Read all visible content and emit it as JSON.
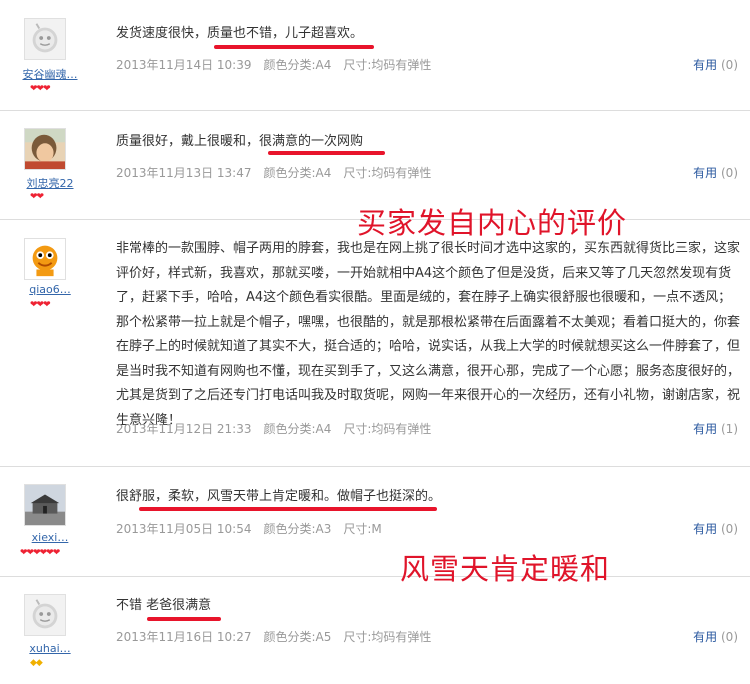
{
  "reviews": [
    {
      "avatar_icon": "default-avatar-icon",
      "username": "安谷幽魂…",
      "rank": "❤❤❤",
      "text": "发货速度很快，质量也不错，儿子超喜欢。",
      "date": "2013年11月14日 10:39",
      "color": "颜色分类:A4",
      "size": "尺寸:均码有弹性",
      "useful_label": "有用",
      "useful_count": "(0)"
    },
    {
      "avatar_icon": "user-photo-icon",
      "username": "刘忠亮22",
      "rank": "❤❤",
      "text": "质量很好，戴上很暖和，很满意的一次网购",
      "date": "2013年11月13日 13:47",
      "color": "颜色分类:A4",
      "size": "尺寸:均码有弹性",
      "useful_label": "有用",
      "useful_count": "(0)"
    },
    {
      "avatar_icon": "orange-cartoon-avatar-icon",
      "username": "qiao6…",
      "rank": "❤❤❤",
      "text": "非常棒的一款围脖、帽子两用的脖套，我也是在网上挑了很长时间才选中这家的，买东西就得货比三家，这家评价好，样式新，我喜欢，那就买喽，一开始就相中A4这个颜色了但是没货，后来又等了几天忽然发现有货了，赶紧下手，哈哈，A4这个颜色看实很酷。里面是绒的，套在脖子上确实很舒服也很暖和，一点不透风；那个松紧带一拉上就是个帽子，嘿嘿，也很酷的，就是那根松紧带在后面露着不太美观；看着口挺大的，你套在脖子上的时候就知道了其实不大，挺合适的；哈哈，说实话，从我上大学的时候就想买这么一件脖套了，但是当时我不知道有网购也不懂，现在买到手了，又这么满意，很开心那，完成了一个心愿；服务态度很好的，尤其是货到了之后还专门打电话叫我及时取货呢，网购一年来很开心的一次经历，还有小礼物，谢谢店家，祝生意兴隆！",
      "date": "2013年11月12日 21:33",
      "color": "颜色分类:A4",
      "size": "尺寸:均码有弹性",
      "useful_label": "有用",
      "useful_count": "(1)"
    },
    {
      "avatar_icon": "building-photo-icon",
      "username": "xiexi…",
      "rank": "❤❤❤❤❤❤",
      "text": "很舒服，柔软，风雪天带上肯定暖和。做帽子也挺深的。",
      "date": "2013年11月05日 10:54",
      "color": "颜色分类:A3",
      "size": "尺寸:M",
      "useful_label": "有用",
      "useful_count": "(0)"
    },
    {
      "avatar_icon": "default-avatar-icon",
      "username": "xuhai…",
      "rank": "◆◆",
      "text": "不错 老爸很满意",
      "date": "2013年11月16日 10:27",
      "color": "颜色分类:A5",
      "size": "尺寸:均码有弹性",
      "useful_label": "有用",
      "useful_count": "(0)"
    }
  ],
  "annotations": {
    "first": "买家发自内心的评价",
    "second": "风雪天肯定暖和"
  },
  "colors": {
    "mark": "#e8142b",
    "link": "#2c5aa0",
    "muted": "#999999"
  }
}
